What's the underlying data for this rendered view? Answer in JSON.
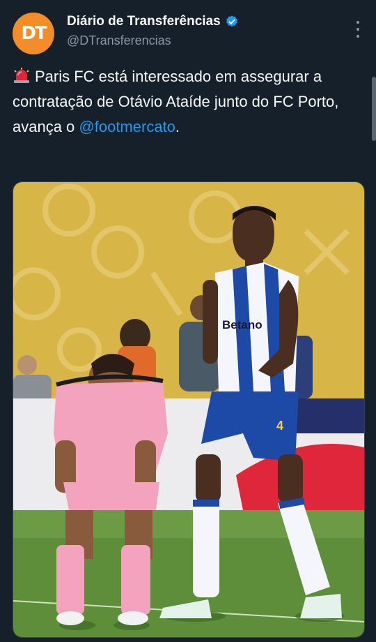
{
  "account": {
    "avatar_text": "DT",
    "display_name": "Diário de Transferências",
    "handle": "@DTransferencias",
    "verified": true
  },
  "tweet": {
    "emoji": "siren-icon",
    "text_before": "Paris FC está interessado em assegurar a contratação de Otávio Ataíde junto do FC Porto, avança o ",
    "mention": "@footmercato",
    "text_after": "."
  },
  "media": {
    "shirt_sponsor": "Betano",
    "shirt_number": "4"
  },
  "colors": {
    "background": "#15202b",
    "link": "#1d9bf0",
    "avatar": "#f28d28",
    "secondary_text": "#8b98a5"
  }
}
